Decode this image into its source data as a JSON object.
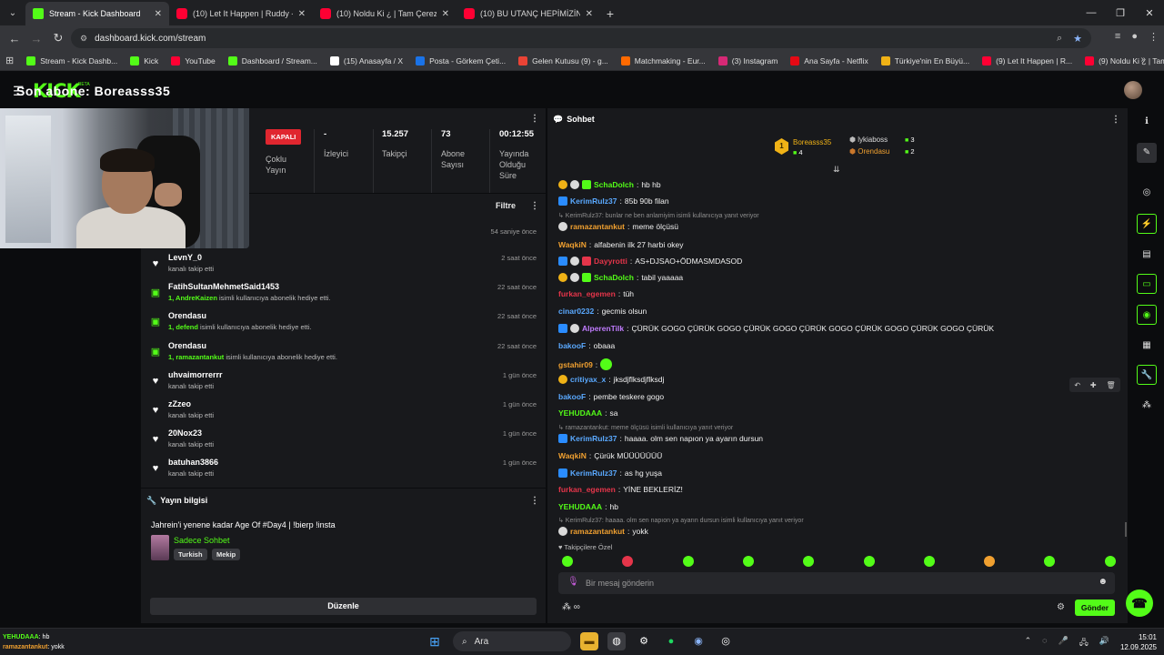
{
  "browser": {
    "tabs": [
      {
        "label": "Stream - Kick Dashboard",
        "type": "kick",
        "active": true
      },
      {
        "label": "(10) Let It Happen | Ruddy - Yo",
        "type": "yt"
      },
      {
        "label": "(10) Noldu Ki ¿ | Tam Çerezlik |",
        "type": "yt"
      },
      {
        "label": "(10) BU UTANÇ HEPİMİZİN | Ma",
        "type": "yt"
      }
    ],
    "url": "dashboard.kick.com/stream",
    "bookmarks": [
      {
        "label": "Stream - Kick Dashb...",
        "color": "#53fc18"
      },
      {
        "label": "Kick",
        "color": "#53fc18"
      },
      {
        "label": "YouTube",
        "color": "#ff0033"
      },
      {
        "label": "Dashboard / Stream...",
        "color": "#53fc18"
      },
      {
        "label": "(15) Anasayfa / X",
        "color": "#ffffff"
      },
      {
        "label": "Posta - Görkem Çeti...",
        "color": "#1a73e8"
      },
      {
        "label": "Gelen Kutusu (9) - g...",
        "color": "#ea4335"
      },
      {
        "label": "Matchmaking - Eur...",
        "color": "#ff6a00"
      },
      {
        "label": "(3) Instagram",
        "color": "#d62976"
      },
      {
        "label": "Ana Sayfa - Netflix",
        "color": "#e50914"
      },
      {
        "label": "Türkiye'nin En Büyü...",
        "color": "#f0b216"
      },
      {
        "label": "(9) Let It Happen | R...",
        "color": "#ff0033"
      },
      {
        "label": "(9) Noldu Ki ¿ | Tam...",
        "color": "#ff0033"
      }
    ]
  },
  "header": {
    "logo": "KICK",
    "logo_beta": "BETA",
    "overlay": "Son abone: Boreasss35"
  },
  "stats": {
    "status_badge": "KAPALI",
    "status_label": "Çoklu Yayın",
    "viewers_value": "-",
    "viewers_label": "İzleyici",
    "followers_value": "15.257",
    "followers_label": "Takipçi",
    "subs_value": "73",
    "subs_label": "Abone Sayısı",
    "uptime_value": "00:12:55",
    "uptime_label": "Yayında Olduğu Süre"
  },
  "activity": {
    "filter_label": "Filtre",
    "first_time": "54 saniye önce",
    "items": [
      {
        "icon": "heart",
        "name": "LevnY_0",
        "sub_user": "",
        "sub": "kanalı takip etti",
        "time": "2 saat önce"
      },
      {
        "icon": "gift",
        "name": "FatihSultanMehmetSaid1453",
        "sub_user": "1, AndreKaizen",
        "sub": "isimli kullanıcıya abonelik hediye etti.",
        "time": "22 saat önce"
      },
      {
        "icon": "gift",
        "name": "Orendasu",
        "sub_user": "1, defend",
        "sub": "isimli kullanıcıya abonelik hediye etti.",
        "time": "22 saat önce"
      },
      {
        "icon": "gift",
        "name": "Orendasu",
        "sub_user": "1, ramazantankut",
        "sub": "isimli kullanıcıya abonelik hediye etti.",
        "time": "22 saat önce"
      },
      {
        "icon": "heart",
        "name": "uhvaimorrerrr",
        "sub_user": "",
        "sub": "kanalı takip etti",
        "time": "1 gün önce"
      },
      {
        "icon": "heart",
        "name": "zZzeo",
        "sub_user": "",
        "sub": "kanalı takip etti",
        "time": "1 gün önce"
      },
      {
        "icon": "heart",
        "name": "20Nox23",
        "sub_user": "",
        "sub": "kanalı takip etti",
        "time": "1 gün önce"
      },
      {
        "icon": "heart",
        "name": "batuhan3866",
        "sub_user": "",
        "sub": "kanalı takip etti",
        "time": "1 gün önce"
      }
    ]
  },
  "stream_info": {
    "title": "Yayın bilgisi",
    "stream_title": "Jahrein'i yenene kadar Age Of #Day4 | !bierp !insta",
    "category": "Sadece Sohbet",
    "tags": [
      "Turkish",
      "Mekip"
    ],
    "edit_label": "Düzenle"
  },
  "chat": {
    "title": "Sohbet",
    "leaderboard": {
      "rank": "1",
      "first_name": "Boreasss35",
      "first_count": "4",
      "second_name": "lykiaboss",
      "second_count": "3",
      "third_name": "Orendasu",
      "third_count": "2"
    },
    "messages": [
      {
        "type": "msg",
        "badges": [
          "gold",
          "av",
          "sub"
        ],
        "user": "SchaDolch",
        "color": "#53fc18",
        "text": "hb hb"
      },
      {
        "type": "msg",
        "badges": [
          "mod"
        ],
        "user": "KerimRulz37",
        "color": "#5aa9ff",
        "text": "85b 90b filan"
      },
      {
        "type": "reply",
        "text": "↳ KerimRulz37: bunlar ne ben anlamiyim      isimli kullanıcıya yanıt veriyor"
      },
      {
        "type": "msg",
        "badges": [
          "av"
        ],
        "user": "ramazantankut",
        "color": "#f0a030",
        "text": "meme ölçüsü"
      },
      {
        "type": "msg",
        "badges": [],
        "user": "WaqkiN",
        "color": "#f0a030",
        "text": "alfabenin ilk 27 harbi okey"
      },
      {
        "type": "msg",
        "badges": [
          "mod",
          "av",
          "red"
        ],
        "user": "Dayyrotti",
        "color": "#e5354a",
        "text": "AS+DJSAO+ÖDMASMDASOD"
      },
      {
        "type": "msg",
        "badges": [
          "gold",
          "av",
          "sub"
        ],
        "user": "SchaDolch",
        "color": "#53fc18",
        "text": "tabil yaaaaa"
      },
      {
        "type": "msg",
        "badges": [],
        "user": "furkan_egemen",
        "color": "#e5354a",
        "text": "tüh"
      },
      {
        "type": "msg",
        "badges": [],
        "user": "cinar0232",
        "color": "#5aa9ff",
        "text": "gecmis olsun"
      },
      {
        "type": "msg",
        "badges": [
          "mod",
          "av"
        ],
        "user": "AlperenTilk",
        "color": "#c07cff",
        "text": "ÇÜRÜK GOGO ÇÜRÜK GOGO ÇÜRÜK GOGO ÇÜRÜK GOGO ÇÜRÜK GOGO ÇÜRÜK GOGO ÇÜRÜK"
      },
      {
        "type": "msg",
        "badges": [],
        "user": "bakooF",
        "color": "#5aa9ff",
        "text": "obaaa"
      },
      {
        "type": "msg",
        "badges": [],
        "user": "gstahir09",
        "color": "#f0a030",
        "text": "",
        "emote": true
      },
      {
        "type": "msg",
        "badges": [
          "gold"
        ],
        "user": "critiyax_x",
        "color": "#5aa9ff",
        "text": "jksdjflksdjflksdj"
      },
      {
        "type": "msg",
        "badges": [],
        "user": "bakooF",
        "color": "#5aa9ff",
        "text": "pembe teskere gogo"
      },
      {
        "type": "msg",
        "badges": [],
        "user": "YEHUDAAA",
        "color": "#53fc18",
        "text": "sa"
      },
      {
        "type": "reply",
        "text": "↳ ramazantankut: meme ölçüsü isimli kullanıcıya yanıt veriyor"
      },
      {
        "type": "msg",
        "badges": [
          "mod"
        ],
        "user": "KerimRulz37",
        "color": "#5aa9ff",
        "text": "haaaa. olm sen napıon ya ayarın dursun"
      },
      {
        "type": "msg",
        "badges": [],
        "user": "WaqkiN",
        "color": "#f0a030",
        "text": "Çürük MÜÜÜÜÜÜÜ"
      },
      {
        "type": "msg",
        "badges": [
          "mod"
        ],
        "user": "KerimRulz37",
        "color": "#5aa9ff",
        "text": "as hg yuşa"
      },
      {
        "type": "msg",
        "badges": [],
        "user": "furkan_egemen",
        "color": "#e5354a",
        "text": "YİNE BEKLERİZ!"
      },
      {
        "type": "msg",
        "badges": [],
        "user": "YEHUDAAA",
        "color": "#53fc18",
        "text": "hb"
      },
      {
        "type": "reply",
        "text": "↳ KerimRulz37: haaaa. olm sen napıon ya ayarın dursun isimli kullanıcıya yanıt veriyor"
      },
      {
        "type": "msg",
        "badges": [
          "av"
        ],
        "user": "ramazantankut",
        "color": "#f0a030",
        "text": "yokk"
      }
    ],
    "followers_only": "♥ Takipçilere Özel",
    "input_placeholder": "Bir mesaj gönderin",
    "send_label": "Gönder"
  },
  "taskbar": {
    "ticker_user1": "YEHUDAAA",
    "ticker_text1": ": hb",
    "ticker_user2": "ramazantankut",
    "ticker_text2": ": yokk",
    "search_label": "Ara",
    "time": "15:01",
    "date": "12.09.2025"
  }
}
